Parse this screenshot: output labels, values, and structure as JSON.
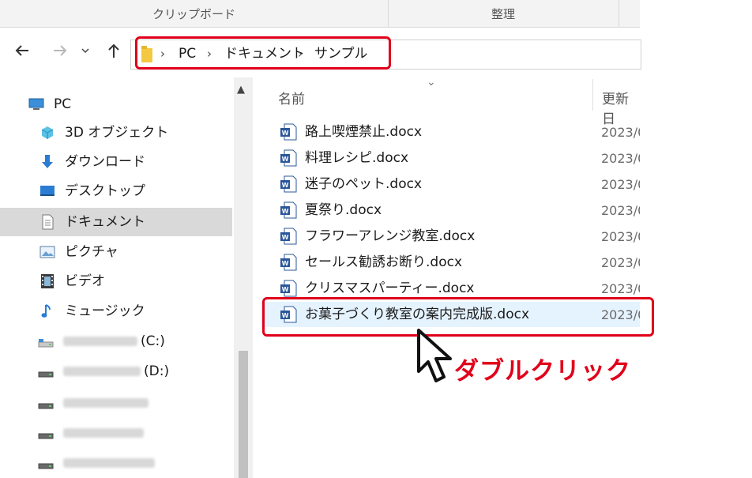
{
  "ribbon": {
    "group1": "クリップボード",
    "group2": "整理"
  },
  "nav": {
    "back_icon": "arrow-left-icon",
    "forward_icon": "arrow-right-icon",
    "recent_icon": "chevron-down-icon",
    "up_icon": "arrow-up-icon"
  },
  "breadcrumb": {
    "items": [
      "PC",
      "ドキュメント",
      "サンプル"
    ],
    "separator": "›"
  },
  "sidebar": {
    "items": [
      {
        "label": "PC",
        "icon": "monitor-icon"
      },
      {
        "label": "3D オブジェクト",
        "icon": "cube-icon"
      },
      {
        "label": "ダウンロード",
        "icon": "download-arrow-icon"
      },
      {
        "label": "デスクトップ",
        "icon": "desktop-icon"
      },
      {
        "label": "ドキュメント",
        "icon": "document-icon",
        "selected": true
      },
      {
        "label": "ピクチャ",
        "icon": "picture-icon"
      },
      {
        "label": "ビデオ",
        "icon": "film-icon"
      },
      {
        "label": "ミュージック",
        "icon": "music-note-icon"
      },
      {
        "label": "(C:)",
        "icon": "drive-icon"
      },
      {
        "label": "(D:)",
        "icon": "drive-icon"
      },
      {
        "label": "",
        "icon": "drive-icon"
      },
      {
        "label": "",
        "icon": "drive-icon"
      },
      {
        "label": "",
        "icon": "drive-icon"
      }
    ]
  },
  "list": {
    "columns": {
      "name": "名前",
      "date": "更新日"
    },
    "files": [
      {
        "name": "路上喫煙禁止.docx",
        "date": "2023/0"
      },
      {
        "name": "料理レシピ.docx",
        "date": "2023/0"
      },
      {
        "name": "迷子のペット.docx",
        "date": "2023/0"
      },
      {
        "name": "夏祭り.docx",
        "date": "2023/0"
      },
      {
        "name": "フラワーアレンジ教室.docx",
        "date": "2023/0"
      },
      {
        "name": "セールス勧誘お断り.docx",
        "date": "2023/0"
      },
      {
        "name": "クリスマスパーティー.docx",
        "date": "2023/0"
      },
      {
        "name": "お菓子づくり教室の案内完成版.docx",
        "date": "2023/0"
      }
    ]
  },
  "annotation": {
    "text": "ダブルクリック"
  },
  "colors": {
    "highlight": "#e1001a",
    "selection": "#cce8ff",
    "word_blue": "#2b579a",
    "folder": "#f5c842"
  }
}
